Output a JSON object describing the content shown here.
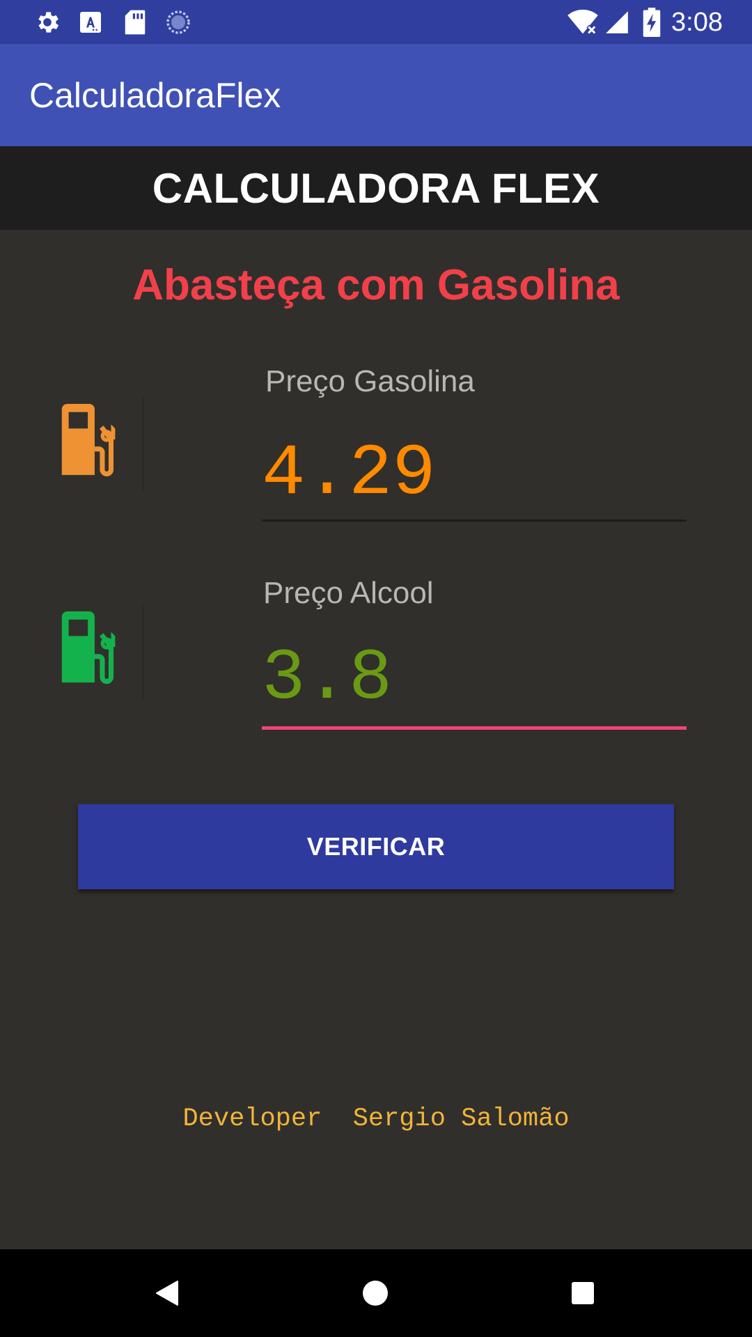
{
  "status_bar": {
    "time": "3:08",
    "left_icons": [
      "gear-icon",
      "text-format-icon",
      "sd-card-icon",
      "sync-circle-icon"
    ],
    "right_icons": [
      "wifi-off-icon",
      "signal-icon",
      "battery-charging-icon"
    ]
  },
  "app_bar": {
    "title": "CalculadoraFlex"
  },
  "header": {
    "title": "CALCULADORA FLEX"
  },
  "result": {
    "text": "Abasteça com Gasolina",
    "color": "#f2404a"
  },
  "gasoline": {
    "label": "Preço Gasolina",
    "value": "4.29",
    "icon": "gas-pump-icon",
    "icon_color": "#ee9233",
    "value_color": "#ff8a00"
  },
  "alcohol": {
    "label": "Preço Alcool",
    "value": "3.8",
    "icon": "gas-pump-icon",
    "icon_color": "#14b24c",
    "value_color": "#6a9a14",
    "focused": true
  },
  "verify_button": {
    "label": "VERIFICAR"
  },
  "footer": {
    "developer_text": "Developer  Sergio Salomão"
  },
  "nav_bar": {
    "buttons": [
      "back-icon",
      "home-icon",
      "recents-icon"
    ]
  },
  "colors": {
    "primary": "#3f51b5",
    "primary_dark": "#303f9f",
    "accent": "#ff4081",
    "background": "#312f2b"
  }
}
